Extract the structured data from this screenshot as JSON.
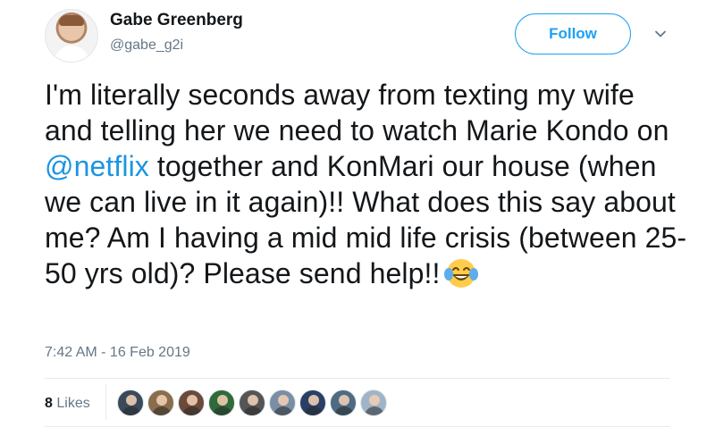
{
  "tweet": {
    "display_name": "Gabe Greenberg",
    "handle": "@gabe_g2i",
    "follow_label": "Follow",
    "text_before": "I'm literally seconds away from texting my wife and telling her we need to watch Marie Kondo on ",
    "mention": "@netflix",
    "text_after": " together and KonMari our house (when we can live in it again)!! What does this say about me? Am I having a mid mid life crisis (between 25-50 yrs old)? Please send help!!",
    "emoji": "face-with-tears-of-joy-icon",
    "timestamp": "7:42 AM - 16 Feb 2019",
    "likes_count": "8",
    "likes_label": "Likes",
    "liker_colors": [
      "#3a4a5a",
      "#8a6d4b",
      "#6b4a3a",
      "#2f6b3a",
      "#555555",
      "#7a8fa6",
      "#2b3f66",
      "#4d6b85",
      "#a0b4c8"
    ]
  },
  "colors": {
    "accent": "#1da1f2",
    "mention": "#1b95e0",
    "muted": "#657786",
    "text": "#14171a"
  }
}
